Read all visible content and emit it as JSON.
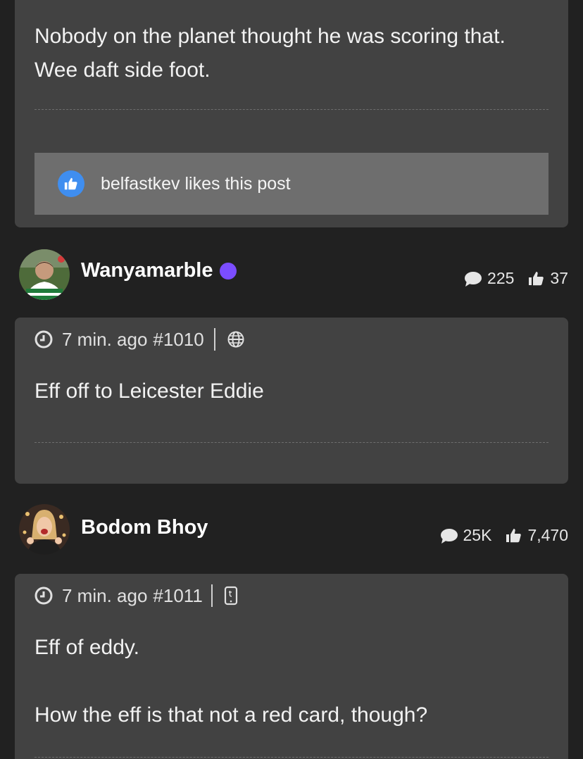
{
  "posts": {
    "previous": {
      "text_line1": "Nobody on the planet thought he was scoring that.",
      "text_line2": "Wee daft side foot.",
      "likes_text": "belfastkev likes this post"
    },
    "p1010": {
      "username": "Wanyamarble",
      "posts_count": "225",
      "likes_count": "37",
      "time": "7 min. ago",
      "post_number": "#1010",
      "source_icon": "globe-icon",
      "text": "Eff off to Leicester Eddie"
    },
    "p1011": {
      "username": "Bodom Bhoy",
      "posts_count": "25K",
      "likes_count": "7,470",
      "time": "7 min. ago",
      "post_number": "#1011",
      "source_icon": "mobile-icon",
      "text_line1": "Eff of eddy.",
      "text_line2": "How the eff is that not a red card, though?"
    }
  },
  "colors": {
    "background": "#212121",
    "card": "#424242",
    "likes_box": "#6e6e6e",
    "like_badge": "#3f8ef0",
    "online_dot": "#7b4dff"
  }
}
